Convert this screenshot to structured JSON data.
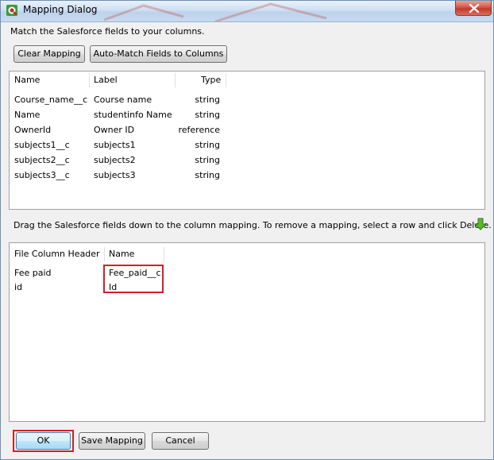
{
  "window": {
    "title": "Mapping Dialog",
    "accent_color": "#d0202a"
  },
  "instruction": "Match the Salesforce fields to your columns.",
  "toolbar": {
    "clear_label": "Clear Mapping",
    "auto_match_label": "Auto-Match Fields to Columns"
  },
  "fields_table": {
    "columns": [
      "Name",
      "Label",
      "Type"
    ],
    "rows": [
      {
        "name": "Course_name__c",
        "label": "Course name",
        "type": "string"
      },
      {
        "name": "Name",
        "label": "studentinfo Name",
        "type": "string"
      },
      {
        "name": "OwnerId",
        "label": "Owner ID",
        "type": "reference"
      },
      {
        "name": "subjects1__c",
        "label": "subjects1",
        "type": "string"
      },
      {
        "name": "subjects2__c",
        "label": "subjects2",
        "type": "string"
      },
      {
        "name": "subjects3__c",
        "label": "subjects3",
        "type": "string"
      }
    ]
  },
  "drag_instruction": "Drag the Salesforce fields down to the column mapping.  To remove a mapping, select a row and click Delete.",
  "mapping_table": {
    "columns": [
      "File Column Header",
      "Name"
    ],
    "rows": [
      {
        "header": "Fee paid",
        "name": "Fee_paid__c"
      },
      {
        "header": "id",
        "name": "Id"
      }
    ]
  },
  "footer": {
    "ok_label": "OK",
    "save_label": "Save Mapping",
    "cancel_label": "Cancel"
  }
}
